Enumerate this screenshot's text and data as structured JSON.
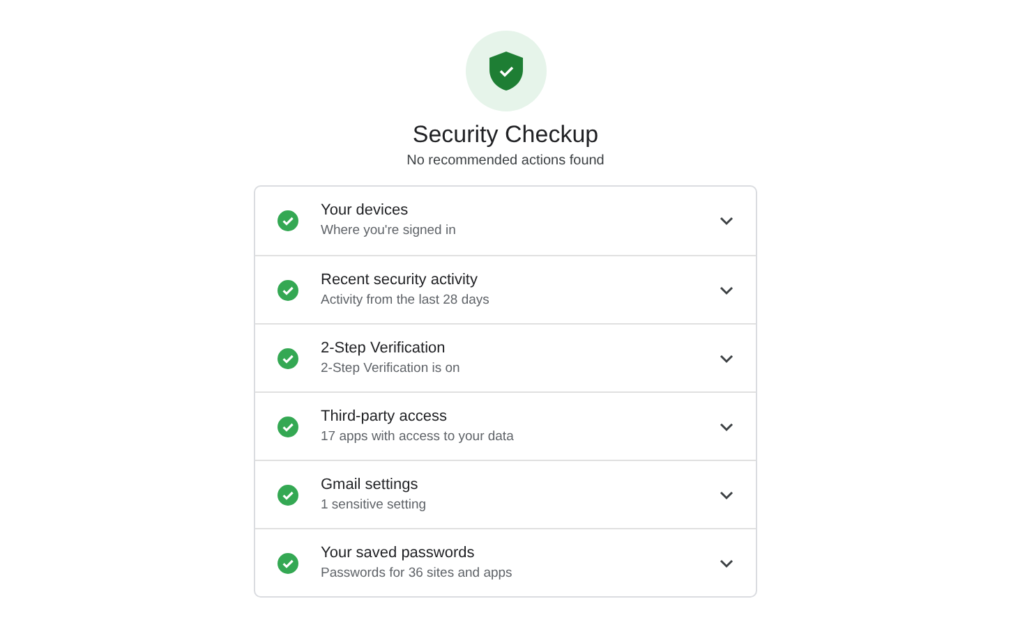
{
  "header": {
    "title": "Security Checkup",
    "subtitle": "No recommended actions found"
  },
  "items": [
    {
      "title": "Your devices",
      "detail": "Where you're signed in",
      "color": "#34a853",
      "expanded": false
    },
    {
      "title": "Recent security activity",
      "detail": "Activity from the last 28 days",
      "color": "#34a853",
      "expanded": false
    },
    {
      "title": "2-Step Verification",
      "detail": "2-Step Verification is on",
      "color": "#34a853",
      "expanded": false
    },
    {
      "title": "Third-party access",
      "detail": "17 apps with access to your data",
      "color": "#34a853",
      "expanded": false
    },
    {
      "title": "Gmail settings",
      "detail": "1 sensitive setting",
      "color": "#34a853",
      "expanded": false
    },
    {
      "title": "Your saved passwords",
      "detail": "Passwords for 36 sites and apps",
      "color": "#34a853",
      "expanded": false
    }
  ]
}
